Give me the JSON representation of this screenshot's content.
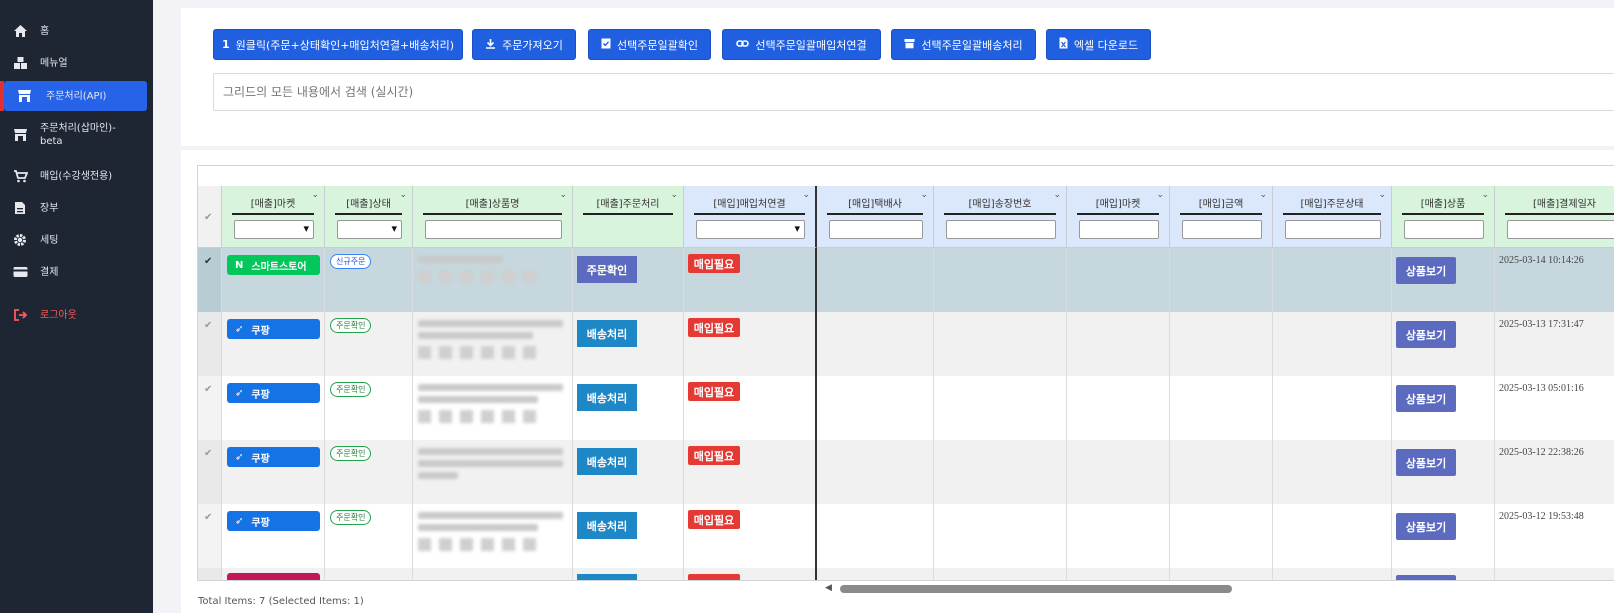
{
  "sidebar": {
    "items": [
      {
        "label": "홈",
        "icon": "home-icon"
      },
      {
        "label": "메뉴얼",
        "icon": "boxes-icon"
      },
      {
        "label": "주문처리(API)",
        "icon": "store-icon"
      },
      {
        "label": "주문처리(삽마인)-beta",
        "icon": "store-icon"
      },
      {
        "label": "매입(수강생전용)",
        "icon": "cart-icon"
      },
      {
        "label": "장부",
        "icon": "document-icon"
      },
      {
        "label": "세팅",
        "icon": "gear-icon"
      },
      {
        "label": "결제",
        "icon": "card-icon"
      },
      {
        "label": "로그아웃",
        "icon": "logout-icon"
      }
    ]
  },
  "toolbar": {
    "btn_oneclick": "원클릭(주문+상태확인+매입처연결+배송처리)",
    "btn_fetch": "주문가져오기",
    "btn_confirm": "선택주문일괄확인",
    "btn_link": "선택주문일괄매입처연결",
    "btn_ship": "선택주문일괄배송처리",
    "btn_excel": "엑셀 다운로드"
  },
  "search": {
    "placeholder": "그리드의 모든 내용에서 검색 (실시간)"
  },
  "grid": {
    "headers": {
      "market": "[매출]마켓",
      "status": "[매출]상태",
      "product": "[매출]상품명",
      "process": "[매출]주문처리",
      "supplier": "[매입]매입처연결",
      "courier": "[매입]택배사",
      "invoice": "[매입]송장번호",
      "pmarket": "[매입]마켓",
      "amount": "[매입]금액",
      "pstatus": "[매입]주문상태",
      "goods": "[매출]상품",
      "paydate": "[매출]결제일자"
    },
    "rows": [
      {
        "market": "스마트스토어",
        "market_icon": "N",
        "status": "신규주문",
        "action": "주문확인",
        "supplier": "매입필요",
        "goods": "상품보기",
        "date": "2025-03-14 10:14:26"
      },
      {
        "market": "쿠팡",
        "market_icon": "rocket-icon",
        "status": "주문확인",
        "action": "배송처리",
        "supplier": "매입필요",
        "goods": "상품보기",
        "date": "2025-03-13 17:31:47"
      },
      {
        "market": "쿠팡",
        "market_icon": "rocket-icon",
        "status": "주문확인",
        "action": "배송처리",
        "supplier": "매입필요",
        "goods": "상품보기",
        "date": "2025-03-13 05:01:16"
      },
      {
        "market": "쿠팡",
        "market_icon": "rocket-icon",
        "status": "주문확인",
        "action": "배송처리",
        "supplier": "매입필요",
        "goods": "상품보기",
        "date": "2025-03-12 22:38:26"
      },
      {
        "market": "쿠팡",
        "market_icon": "rocket-icon",
        "status": "주문확인",
        "action": "배송처리",
        "supplier": "매입필요",
        "goods": "상품보기",
        "date": "2025-03-12 19:53:48"
      }
    ]
  },
  "footer": {
    "total": "Total Items: 7 (Selected Items: 1)"
  },
  "colors": {
    "sidebar_bg": "#1e2533",
    "accent": "#2763e8",
    "smartstore": "#03c75a",
    "coupang": "#1573e6",
    "need": "#e53935"
  }
}
